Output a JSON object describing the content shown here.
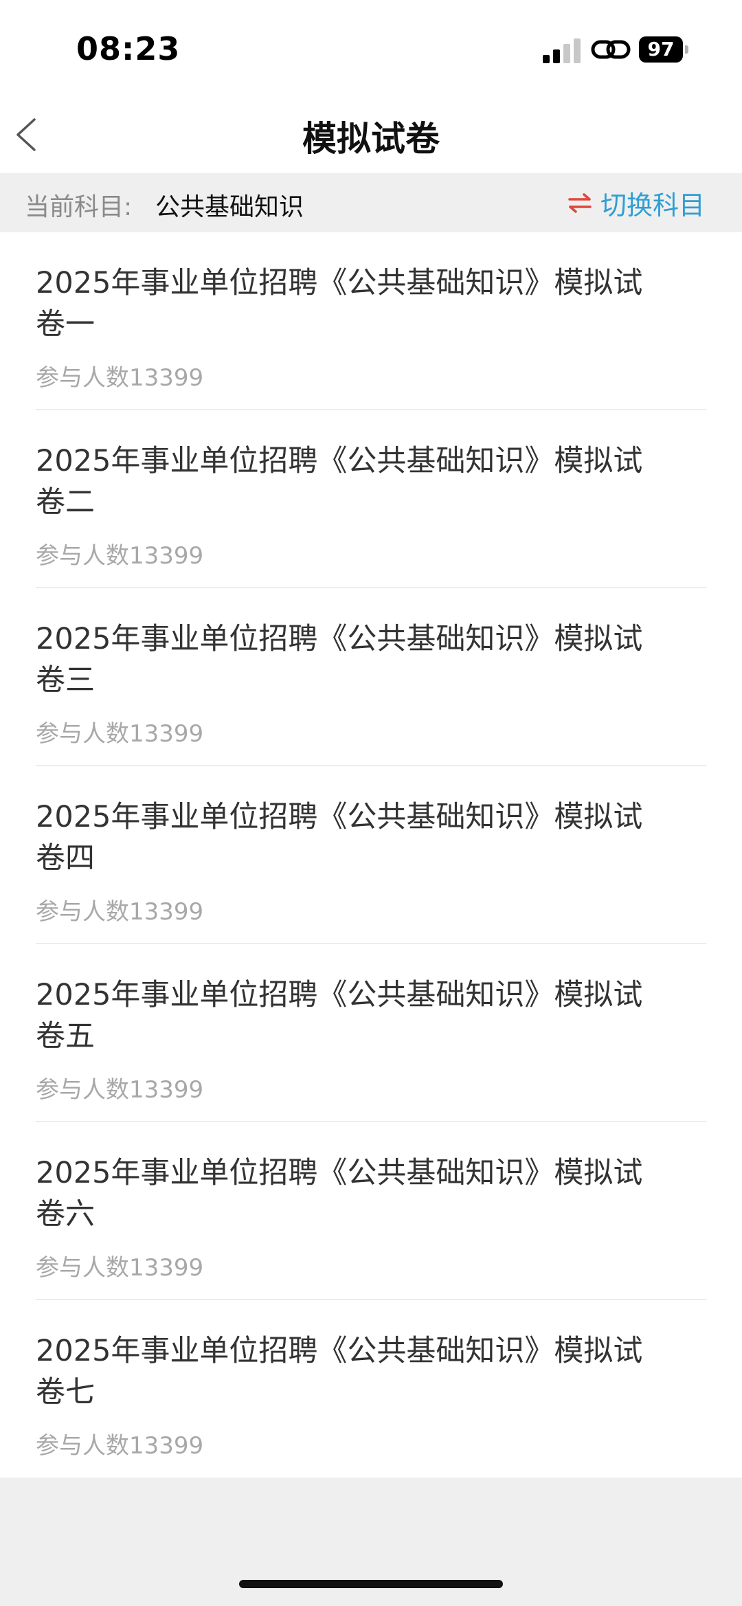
{
  "status_bar": {
    "time": "08:23",
    "battery": "97"
  },
  "header": {
    "title": "模拟试卷"
  },
  "subject": {
    "label": "当前科目:",
    "value": "公共基础知识",
    "switch_label": "切换科目",
    "switch_icon": "swap-arrows-icon",
    "switch_icon_color": "#e0473a",
    "switch_label_color": "#2f9ed3"
  },
  "papers": [
    {
      "title": "2025年事业单位招聘《公共基础知识》模拟试卷一",
      "participants": "参与人数13399"
    },
    {
      "title": "2025年事业单位招聘《公共基础知识》模拟试卷二",
      "participants": "参与人数13399"
    },
    {
      "title": "2025年事业单位招聘《公共基础知识》模拟试卷三",
      "participants": "参与人数13399"
    },
    {
      "title": "2025年事业单位招聘《公共基础知识》模拟试卷四",
      "participants": "参与人数13399"
    },
    {
      "title": "2025年事业单位招聘《公共基础知识》模拟试卷五",
      "participants": "参与人数13399"
    },
    {
      "title": "2025年事业单位招聘《公共基础知识》模拟试卷六",
      "participants": "参与人数13399"
    },
    {
      "title": "2025年事业单位招聘《公共基础知识》模拟试卷七",
      "participants": "参与人数13399"
    }
  ]
}
